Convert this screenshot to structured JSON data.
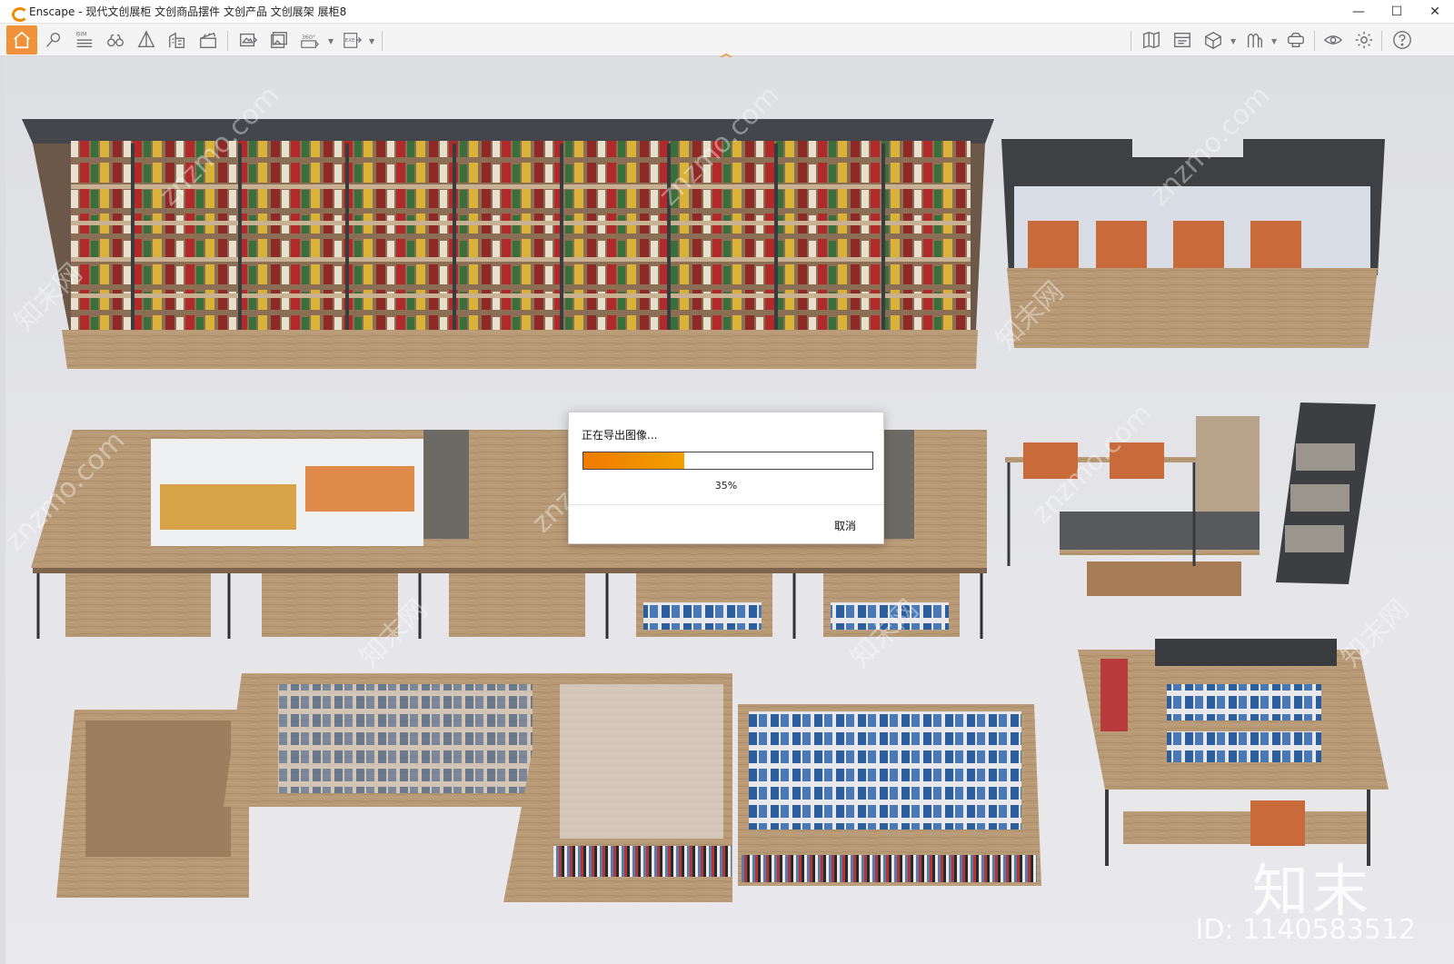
{
  "window": {
    "title": "Enscape - 现代文创展柜 文创商品摆件 文创产品 文创展架 展柜8",
    "minimize_glyph": "—",
    "maximize_glyph": "☐",
    "close_glyph": "✕"
  },
  "toolbar": {
    "left_icons": [
      "home-icon",
      "pin-icon",
      "bim-icon",
      "binoculars-icon",
      "perspective-icon",
      "buildings-icon",
      "clapper-icon",
      "screenshot-icon",
      "batch-render-icon",
      "panorama-360-icon",
      "export-exe-icon"
    ],
    "bim_label": "BIM",
    "panorama_label": "360°",
    "exe_label": "EXE",
    "right_icons": [
      "map-icon",
      "asset-library-icon",
      "cube-view-icon",
      "visual-settings-icon",
      "vr-headset-icon",
      "eye-icon",
      "gear-icon",
      "help-icon"
    ]
  },
  "dialog": {
    "title": "正在导出图像...",
    "progress_percent": 35,
    "progress_text": "35%",
    "cancel_label": "取消"
  },
  "watermark": {
    "logo_text": "知末",
    "id_text": "ID: 1140583512",
    "diagonal_text": "znzmo.com",
    "diagonal_cn": "知末网"
  },
  "colors": {
    "accent": "#f0923c",
    "progress": "#f07a00",
    "wood": "#b89a76",
    "metal": "#3b3c40"
  }
}
